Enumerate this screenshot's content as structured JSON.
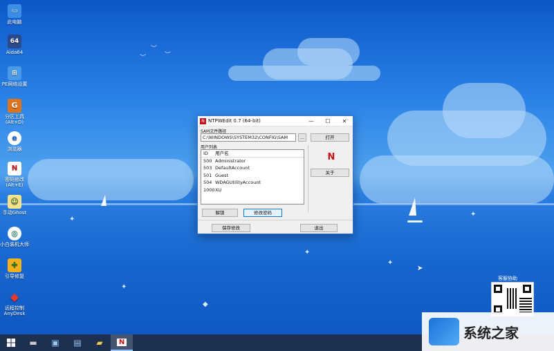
{
  "desktop": {
    "icons": [
      {
        "label": "此电脑",
        "icon": "computer-icon"
      },
      {
        "label": "Aida64",
        "icon": "aida64-icon"
      },
      {
        "label": "PE网络设置",
        "icon": "network-settings-icon"
      },
      {
        "label": "分区工具\n(Alt+D)",
        "icon": "partition-tool-icon"
      },
      {
        "label": "浏览器",
        "icon": "browser-icon"
      },
      {
        "label": "密码修改\n(Alt+E)",
        "icon": "ntpwedit-icon"
      },
      {
        "label": "手动Ghost",
        "icon": "ghost-icon"
      },
      {
        "label": "小白装机大师",
        "icon": "installer-icon"
      },
      {
        "label": "引导修复",
        "icon": "boot-repair-icon"
      },
      {
        "label": "远程控制\nAnyDesk",
        "icon": "anydesk-icon"
      }
    ],
    "support_label": "客服协助"
  },
  "window": {
    "title": "NTPWEdit 0.7 (64-bit)",
    "sam_label": "SAM文件路径",
    "sam_path": "C:\\WINDOWS\\SYSTEM32\\CONFIG\\SAM",
    "browse_label": "...",
    "open_label": "打开",
    "userlist_label": "用户列表",
    "columns": {
      "id": "ID",
      "name": "用户名"
    },
    "users": [
      {
        "id": "500",
        "name": "Administrator"
      },
      {
        "id": "503",
        "name": "DefaultAccount"
      },
      {
        "id": "501",
        "name": "Guest"
      },
      {
        "id": "504",
        "name": "WDAGUtilityAccount"
      },
      {
        "id": "1000",
        "name": "XU"
      }
    ],
    "unlock_label": "解锁",
    "change_password_label": "修改密码",
    "about_label": "关于",
    "save_label": "保存修改",
    "exit_label": "退出",
    "minimize_glyph": "—",
    "maximize_glyph": "☐",
    "close_glyph": "✕"
  },
  "watermark": {
    "text": "系统之家"
  },
  "colors": {
    "accent": "#2b73d8",
    "taskbar": "#1e3050",
    "brand_red": "#c4141b"
  }
}
